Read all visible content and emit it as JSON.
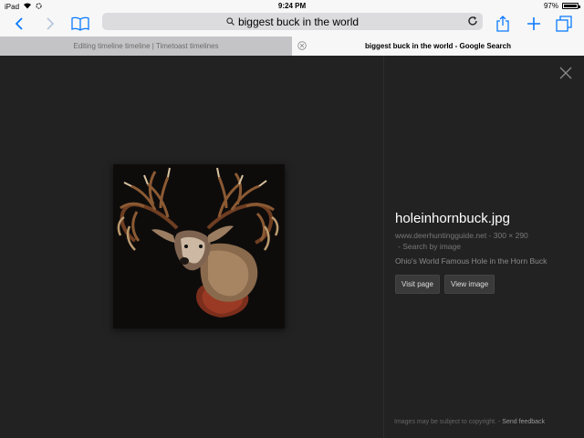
{
  "status_bar": {
    "device": "iPad",
    "time": "9:24 PM",
    "battery_text": "97%",
    "battery_level": 0.97
  },
  "toolbar": {
    "back_icon": "chevron-left-icon",
    "forward_icon": "chevron-right-icon",
    "bookmarks_icon": "book-icon",
    "url_text": "biggest buck in the world",
    "search_icon": "search-icon",
    "reload_icon": "reload-icon",
    "share_icon": "share-icon",
    "new_tab_icon": "plus-icon",
    "tabs_icon": "tabs-icon",
    "accent": "#0a7aff"
  },
  "tabs": [
    {
      "label": "Editing timeline timeline | Timetoast timelines",
      "active": false
    },
    {
      "label": "biggest buck in the world - Google Search",
      "active": true
    }
  ],
  "image_panel": {
    "title": "holeinhornbuck.jpg",
    "source": "www.deerhuntingguide.net - 300 × 290",
    "search_by_image": "- Search by image",
    "description": "Ohio's World Famous Hole in the Horn Buck",
    "visit_page": "Visit page",
    "view_image": "View image"
  },
  "footer": {
    "copyright": "Images may be subject to copyright.",
    "separator": " - ",
    "send_feedback": "Send feedback"
  }
}
